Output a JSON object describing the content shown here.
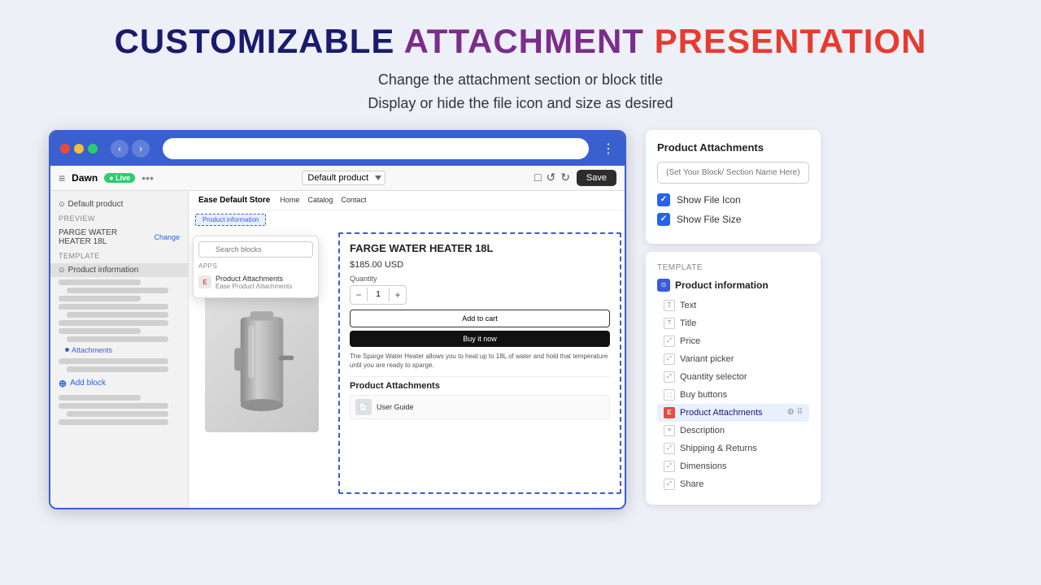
{
  "page": {
    "title_customizable": "CUSTOMIZABLE",
    "title_attachment": "ATTACHMENT",
    "title_presentation": "PRESENTATION",
    "subtitle_line1": "Change the attachment section or block title",
    "subtitle_line2": "Display or hide the file icon and size as desired"
  },
  "browser": {
    "back_label": "‹",
    "forward_label": "›",
    "menu_label": "⋮"
  },
  "editor_bar": {
    "store_name": "Dawn",
    "live_label": "● Live",
    "dots_label": "•••",
    "template_value": "Default product",
    "save_label": "Save"
  },
  "left_sidebar": {
    "default_product_label": "Default product",
    "preview_label": "PREVIEW",
    "change_label": "Change",
    "template_label": "TEMPLATE",
    "product_info_label": "Product information",
    "add_block_label": "Add block"
  },
  "search_blocks": {
    "placeholder": "Search blocks",
    "apps_label": "APPS",
    "app_name": "Product Attachments",
    "app_sub": "Ease Product Attachments",
    "app_icon_label": "E"
  },
  "store_preview": {
    "store_name": "Ease Default Store",
    "nav_items": [
      "Home",
      "Catalog",
      "Contact"
    ],
    "product_info_tab": "Product information",
    "product_title": "FARGE WATER HEATER 18L",
    "product_price": "$185.00 USD",
    "qty_label": "Quantity",
    "qty_value": "1",
    "add_to_cart_label": "Add to cart",
    "buy_now_label": "Buy it now",
    "product_desc": "The Sparge Water Heater allows you to heat up to 18L of water and hold that temperature until you are ready to sparge.",
    "attachments_title": "Product Attachments",
    "attachment_file_name": "User Guide",
    "attachment_icon_label": "📄"
  },
  "settings_panel": {
    "title": "Product Attachments",
    "input_placeholder": "(Set Your Block/ Section Name Here)",
    "show_icon_label": "Show File Icon",
    "show_size_label": "Show File Size",
    "show_icon_checked": true,
    "show_size_checked": true
  },
  "template_panel": {
    "label": "TEMPLATE",
    "section_icon_label": "⊙",
    "section_name": "Product information",
    "items": [
      {
        "id": "text",
        "icon_type": "text",
        "icon_label": "T̲",
        "name": "Text"
      },
      {
        "id": "title",
        "icon_type": "title",
        "icon_label": "T",
        "name": "Title"
      },
      {
        "id": "price",
        "icon_type": "expand",
        "icon_label": "⤢",
        "name": "Price"
      },
      {
        "id": "variant-picker",
        "icon_type": "expand",
        "icon_label": "⤢",
        "name": "Variant picker"
      },
      {
        "id": "quantity-selector",
        "icon_type": "expand",
        "icon_label": "⤢",
        "name": "Quantity selector"
      },
      {
        "id": "buy-buttons",
        "icon_type": "buy",
        "icon_label": "⬚",
        "name": "Buy buttons"
      },
      {
        "id": "product-attachments",
        "icon_type": "app",
        "icon_label": "E",
        "name": "Product Attachments",
        "highlighted": true
      },
      {
        "id": "description",
        "icon_type": "text",
        "icon_label": "≡",
        "name": "Description"
      },
      {
        "id": "shipping-returns",
        "icon_type": "expand",
        "icon_label": "⤢",
        "name": "Shipping & Returns"
      },
      {
        "id": "dimensions",
        "icon_type": "expand",
        "icon_label": "⤢",
        "name": "Dimensions"
      },
      {
        "id": "share",
        "icon_type": "expand",
        "icon_label": "⤢",
        "name": "Share"
      }
    ]
  }
}
